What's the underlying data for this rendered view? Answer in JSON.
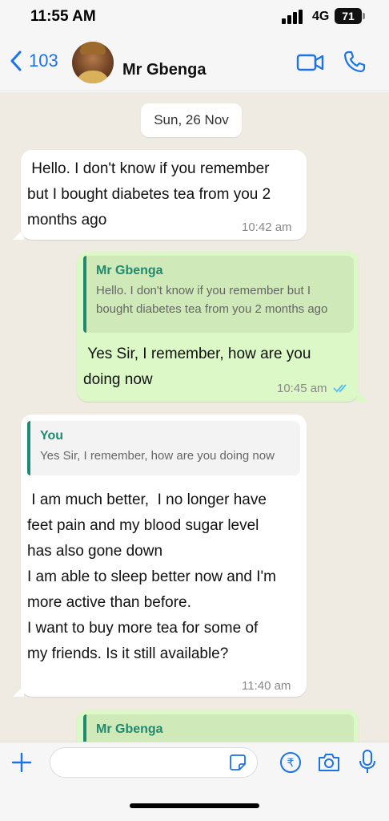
{
  "status_bar": {
    "time": "11:55 AM",
    "network": "4G",
    "battery": "71"
  },
  "header": {
    "back_count": "103",
    "contact_name": "Mr Gbenga",
    "accent_color": "#1a73e8"
  },
  "chat": {
    "date_chip": "Sun, 26 Nov",
    "messages": [
      {
        "direction": "incoming",
        "text": " Hello. I don't know if you remember\nbut I bought diabetes tea from you 2\nmonths ago",
        "time": "10:42 am"
      },
      {
        "direction": "outgoing",
        "quote_author": "Mr Gbenga",
        "quote_text": "Hello. I don't know if you remember but I\nbought diabetes tea from you 2 months ago",
        "text": " Yes Sir, I remember, how are you\ndoing now",
        "time": "10:45 am",
        "status": "read"
      },
      {
        "direction": "incoming",
        "quote_author": "You",
        "quote_text": "Yes Sir, I remember, how are you doing now",
        "text": " I am much better,  I no longer have\nfeet pain and my blood sugar level\nhas also gone down\nI am able to sleep better now and I'm\nmore active than before.\nI want to buy more tea for some of\nmy friends. Is it still available?",
        "time": "11:40 am"
      },
      {
        "direction": "outgoing",
        "quote_author": "Mr Gbenga"
      }
    ]
  },
  "composer": {
    "placeholder": ""
  },
  "colors": {
    "chat_background": "#efeae2",
    "incoming_bubble": "#ffffff",
    "outgoing_bubble": "#dcf8c6",
    "quote_accent": "#1f8a6f",
    "read_ticks": "#53bdeb"
  }
}
